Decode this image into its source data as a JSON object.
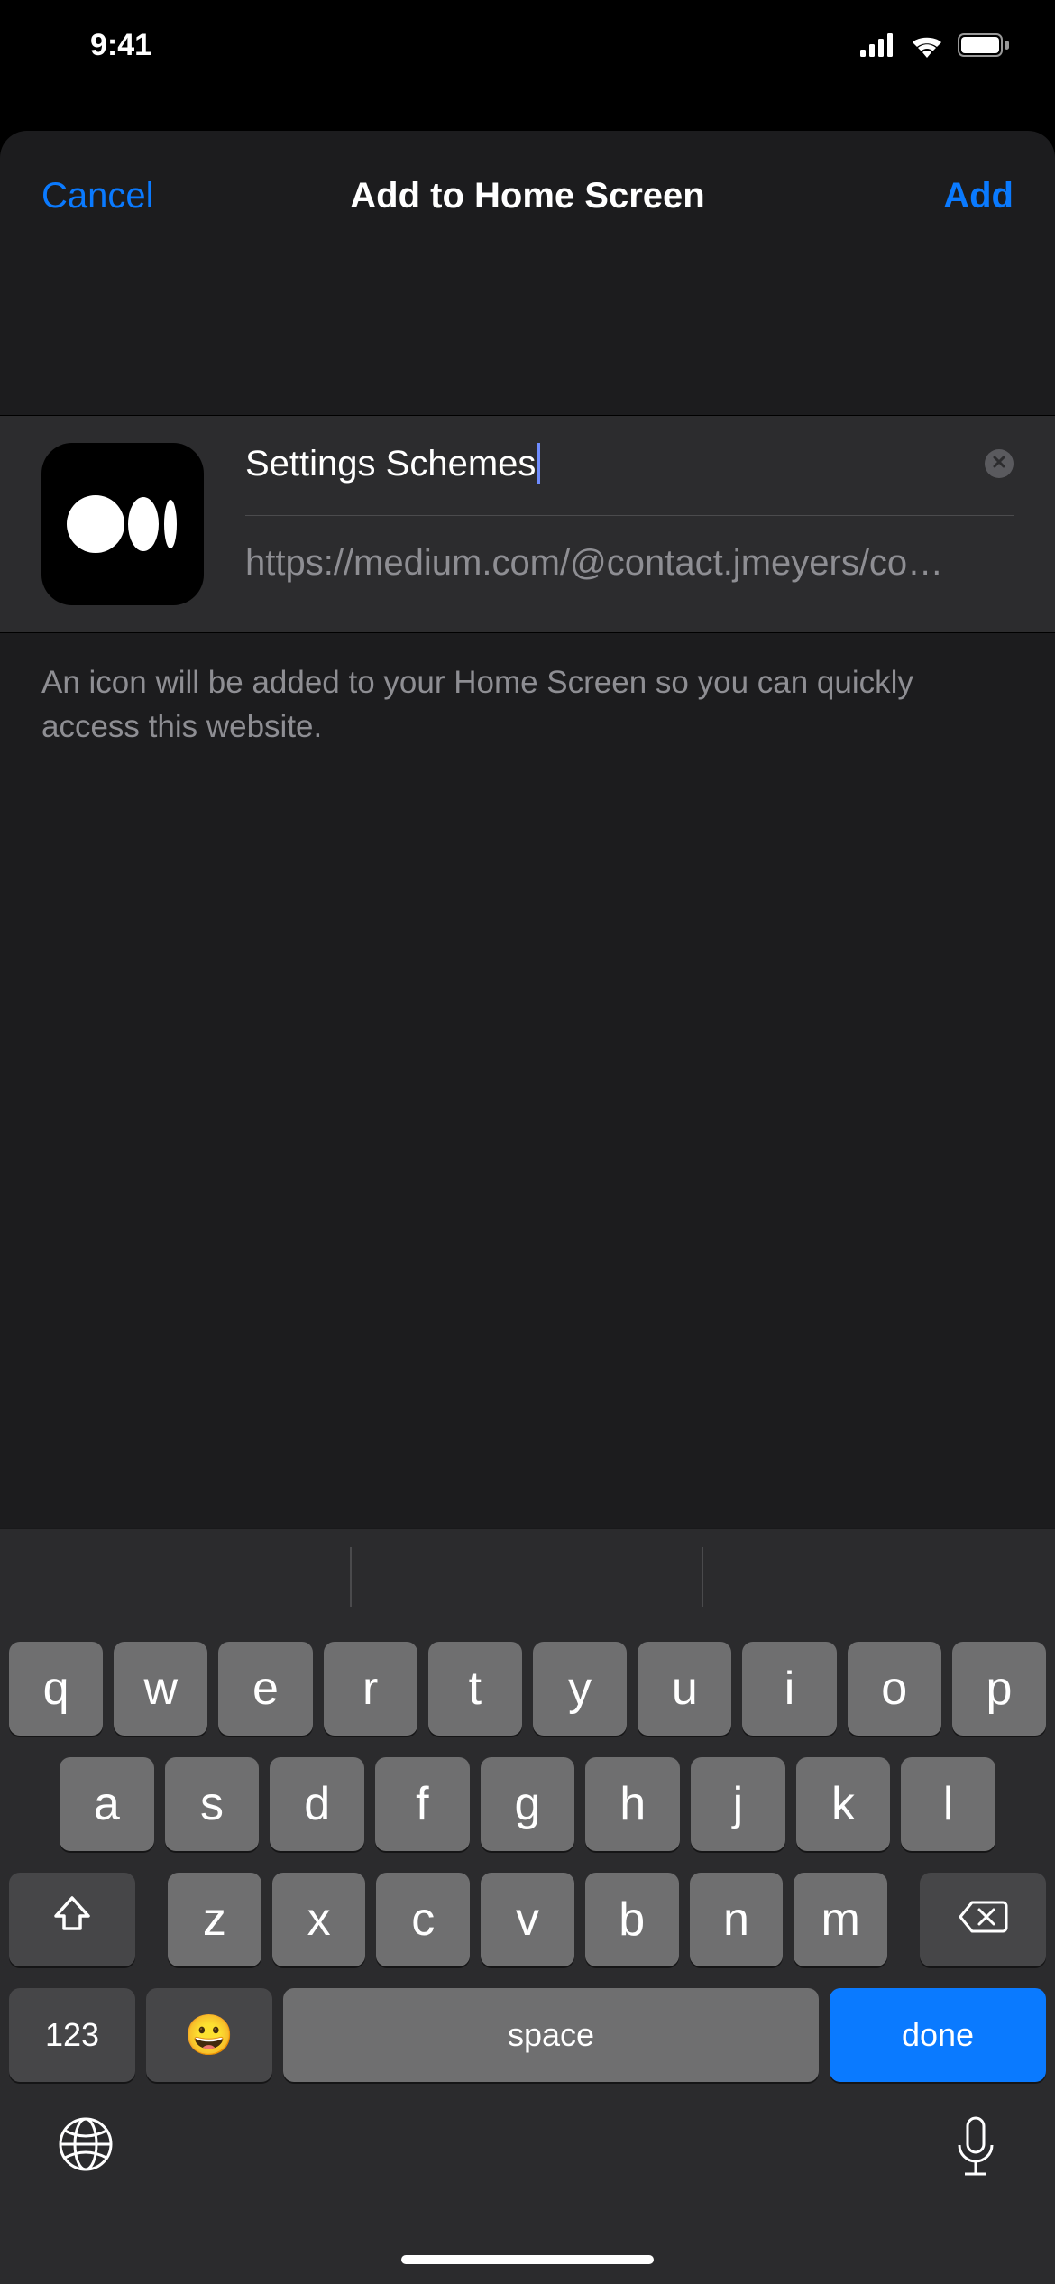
{
  "status": {
    "time": "9:41"
  },
  "nav": {
    "cancel": "Cancel",
    "title": "Add to Home Screen",
    "add": "Add"
  },
  "card": {
    "title_value": "Settings Schemes",
    "url": "https://medium.com/@contact.jmeyers/co…"
  },
  "description": "An icon will be added to your Home Screen so you can quickly access this website.",
  "keyboard": {
    "row1": [
      "q",
      "w",
      "e",
      "r",
      "t",
      "y",
      "u",
      "i",
      "o",
      "p"
    ],
    "row2": [
      "a",
      "s",
      "d",
      "f",
      "g",
      "h",
      "j",
      "k",
      "l"
    ],
    "row3": [
      "z",
      "x",
      "c",
      "v",
      "b",
      "n",
      "m"
    ],
    "key123": "123",
    "space": "space",
    "done": "done"
  }
}
